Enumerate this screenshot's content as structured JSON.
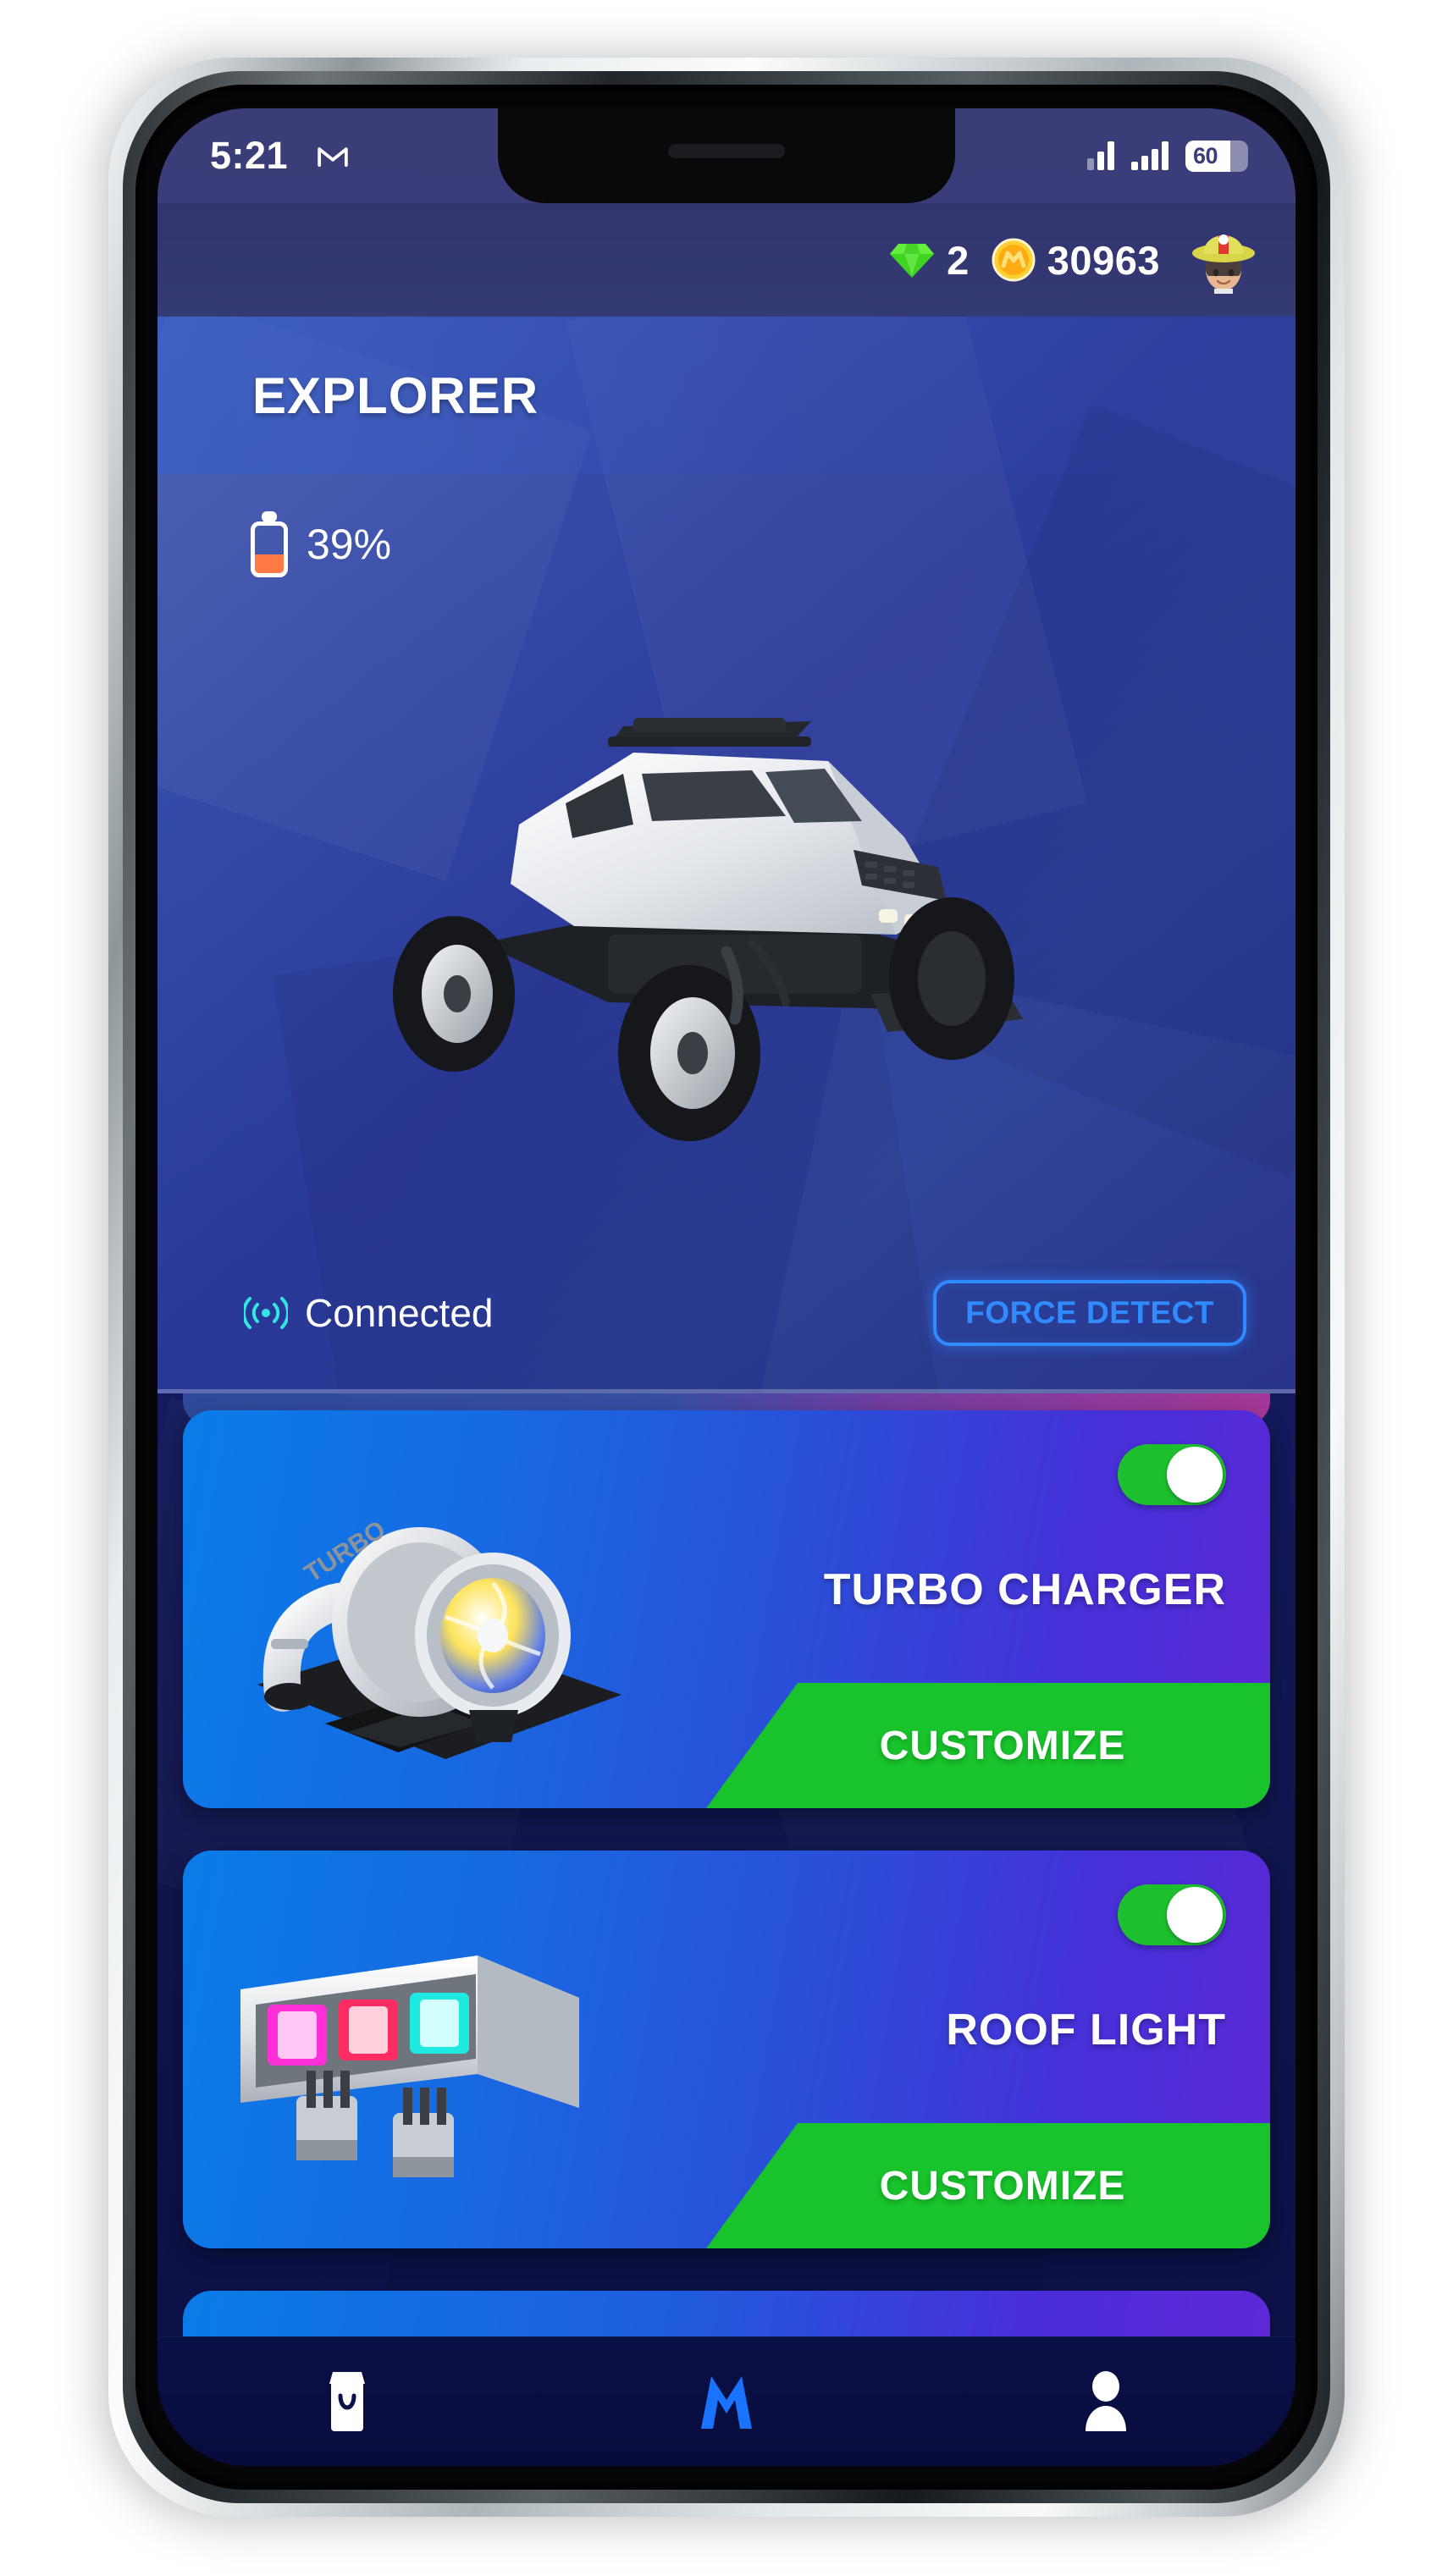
{
  "statusbar": {
    "time": "5:21",
    "gmail_icon": "gmail-m-icon",
    "signal_icon_1": "signal-bars-icon",
    "signal_icon_2": "signal-bars-icon",
    "battery_level_text": "60",
    "battery_percent": 60
  },
  "header": {
    "gem_icon": "gem-icon",
    "gem_count": "2",
    "coin_icon": "coin-icon",
    "coin_count": "30963",
    "avatar_icon": "firefighter-avatar"
  },
  "hero": {
    "title": "EXPLORER",
    "battery_icon": "vertical-battery-icon",
    "battery_text": "39%",
    "battery_percent": 39,
    "vehicle_label": "EXPLORER",
    "vehicle_image": "rc-rock-crawler-truck",
    "connection_icon": "broadcast-signal-icon",
    "connection_status": "Connected",
    "force_detect_label": "FORCE DETECT"
  },
  "accessories": [
    {
      "name": "TURBO CHARGER",
      "art": "turbo-charger-module",
      "toggle_on": true,
      "customize_label": "CUSTOMIZE"
    },
    {
      "name": "ROOF LIGHT",
      "art": "roof-light-bar-module",
      "toggle_on": true,
      "customize_label": "CUSTOMIZE"
    }
  ],
  "bottomnav": {
    "items": [
      {
        "icon": "shop-bag-icon",
        "active": false
      },
      {
        "icon": "brand-m-icon",
        "active": true
      },
      {
        "icon": "profile-person-icon",
        "active": false
      }
    ]
  },
  "colors": {
    "accent_green": "#18c32c",
    "accent_blue": "#2f8bff",
    "battery_orange": "#ff7a45",
    "gem_green": "#3fd622",
    "coin_gold": "#ffad15",
    "brand_blue": "#1a73ff"
  }
}
